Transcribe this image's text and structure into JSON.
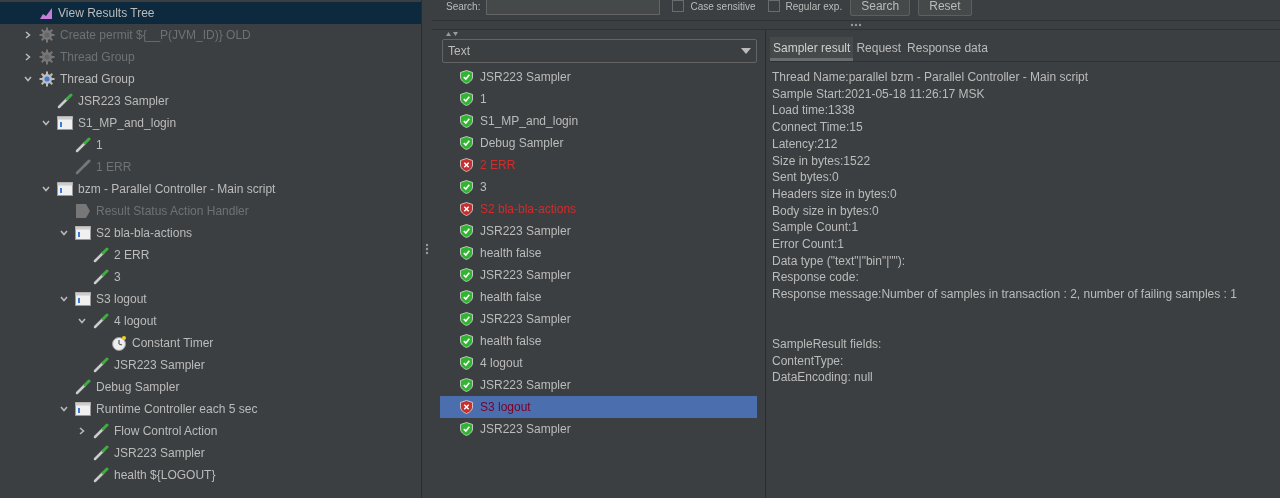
{
  "tree": [
    {
      "label": "View Results Tree",
      "kind": "listener",
      "disabled": false,
      "selected": true
    },
    {
      "label": "Create permit ${__P(JVM_ID)} OLD",
      "kind": "thread_group",
      "disabled": true,
      "selected": false,
      "expanded": false
    },
    {
      "label": "Thread Group",
      "kind": "thread_group",
      "disabled": true,
      "selected": false,
      "expanded": false
    },
    {
      "label": "Thread Group",
      "kind": "thread_group",
      "disabled": false,
      "selected": false,
      "expanded": true,
      "children": [
        {
          "label": "JSR223 Sampler",
          "kind": "sampler",
          "disabled": false,
          "selected": false
        },
        {
          "label": "S1_MP_and_login",
          "kind": "controller",
          "disabled": false,
          "selected": false,
          "expanded": true,
          "children": [
            {
              "label": "1",
              "kind": "sampler",
              "disabled": false,
              "selected": false
            },
            {
              "label": "1 ERR",
              "kind": "sampler",
              "disabled": true,
              "selected": false
            }
          ]
        },
        {
          "label": "bzm - Parallel Controller - Main script",
          "kind": "controller",
          "disabled": false,
          "selected": false,
          "expanded": true,
          "children": [
            {
              "label": "Result Status Action Handler",
              "kind": "handler",
              "disabled": true,
              "selected": false
            },
            {
              "label": "S2 bla-bla-actions",
              "kind": "controller",
              "disabled": false,
              "selected": false,
              "expanded": true,
              "children": [
                {
                  "label": "2 ERR",
                  "kind": "sampler",
                  "disabled": false,
                  "selected": false
                },
                {
                  "label": "3",
                  "kind": "sampler",
                  "disabled": false,
                  "selected": false
                }
              ]
            },
            {
              "label": "S3 logout",
              "kind": "controller",
              "disabled": false,
              "selected": false,
              "expanded": true,
              "children": [
                {
                  "label": "4 logout",
                  "kind": "sampler",
                  "disabled": false,
                  "selected": false,
                  "expanded": true,
                  "children": [
                    {
                      "label": "Constant Timer",
                      "kind": "timer",
                      "disabled": false,
                      "selected": false
                    }
                  ]
                },
                {
                  "label": "JSR223 Sampler",
                  "kind": "sampler",
                  "disabled": false,
                  "selected": false
                }
              ]
            },
            {
              "label": "Debug Sampler",
              "kind": "sampler",
              "disabled": false,
              "selected": false
            },
            {
              "label": "Runtime Controller each 5 sec",
              "kind": "controller",
              "disabled": false,
              "selected": false,
              "expanded": true,
              "children": [
                {
                  "label": "Flow Control Action",
                  "kind": "sampler",
                  "disabled": false,
                  "selected": false,
                  "expanded": false
                },
                {
                  "label": "JSR223 Sampler",
                  "kind": "sampler",
                  "disabled": false,
                  "selected": false
                },
                {
                  "label": "health ${LOGOUT}",
                  "kind": "sampler",
                  "disabled": false,
                  "selected": false
                }
              ]
            }
          ]
        }
      ]
    }
  ],
  "search": {
    "label": "Search:",
    "options": [
      {
        "label": "Case sensitive",
        "checked": false
      },
      {
        "label": "Regular exp.",
        "checked": false
      }
    ],
    "buttons": [
      "Search",
      "Reset"
    ]
  },
  "renderer": {
    "value": "Text"
  },
  "results": [
    {
      "label": "JSR223 Sampler",
      "failed": false,
      "selected": false
    },
    {
      "label": "1",
      "failed": false,
      "selected": false
    },
    {
      "label": "S1_MP_and_login",
      "failed": false,
      "selected": false
    },
    {
      "label": "Debug Sampler",
      "failed": false,
      "selected": false
    },
    {
      "label": "2 ERR",
      "failed": true,
      "selected": false
    },
    {
      "label": "3",
      "failed": false,
      "selected": false
    },
    {
      "label": "S2 bla-bla-actions",
      "failed": true,
      "selected": false
    },
    {
      "label": "JSR223 Sampler",
      "failed": false,
      "selected": false
    },
    {
      "label": "health false",
      "failed": false,
      "selected": false
    },
    {
      "label": "JSR223 Sampler",
      "failed": false,
      "selected": false
    },
    {
      "label": "health false",
      "failed": false,
      "selected": false
    },
    {
      "label": "JSR223 Sampler",
      "failed": false,
      "selected": false
    },
    {
      "label": "health false",
      "failed": false,
      "selected": false
    },
    {
      "label": "4 logout",
      "failed": false,
      "selected": false
    },
    {
      "label": "JSR223 Sampler",
      "failed": false,
      "selected": false
    },
    {
      "label": "S3 logout",
      "failed": true,
      "selected": true
    },
    {
      "label": "JSR223 Sampler",
      "failed": false,
      "selected": false
    }
  ],
  "detail_tabs": [
    {
      "label": "Sampler result",
      "selected": true
    },
    {
      "label": "Request",
      "selected": false
    },
    {
      "label": "Response data",
      "selected": false
    }
  ],
  "sampler_result": [
    "Thread Name:parallel bzm - Parallel Controller - Main script",
    "Sample Start:2021-05-18 11:26:17 MSK",
    "Load time:1338",
    "Connect Time:15",
    "Latency:212",
    "Size in bytes:1522",
    "Sent bytes:0",
    "Headers size in bytes:0",
    "Body size in bytes:0",
    "Sample Count:1",
    "Error Count:1",
    "Data type (\"text\"|\"bin\"|\"\"):",
    "Response code:",
    "Response message:Number of samples in transaction : 2, number of failing samples : 1"
  ],
  "sample_result_fields": [
    "SampleResult fields:",
    "ContentType:",
    "DataEncoding: null"
  ]
}
